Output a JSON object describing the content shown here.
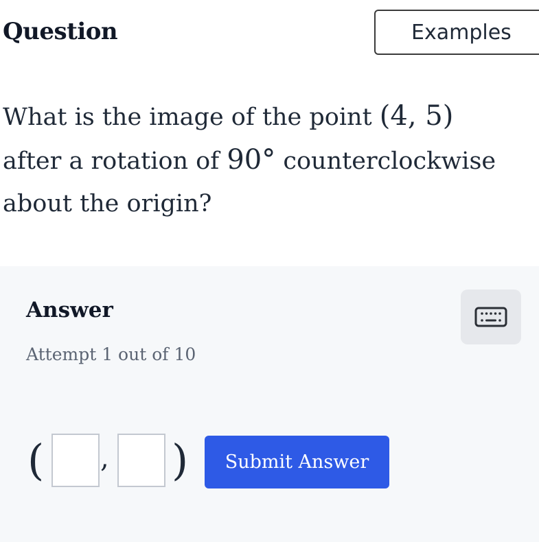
{
  "header": {
    "title": "Question",
    "examples_label": "Examples"
  },
  "question": {
    "line1_text": "What is the image of the point ",
    "line1_math": "(4, 5)",
    "line2_text": "after a rotation of ",
    "line2_math": "90°",
    "line2_text_end": " counterclockwise",
    "line3_text": "about the origin?"
  },
  "answer": {
    "heading": "Answer",
    "attempt": "Attempt 1 out of 10",
    "open_paren": "(",
    "comma": ",",
    "close_paren": ")",
    "x_value": "",
    "y_value": "",
    "submit_label": "Submit Answer",
    "keyboard_icon": "keyboard-icon"
  },
  "colors": {
    "accent": "#2e5ae6",
    "panel_background": "#f6f8fa",
    "keyboard_button": "#e6e8ec"
  }
}
